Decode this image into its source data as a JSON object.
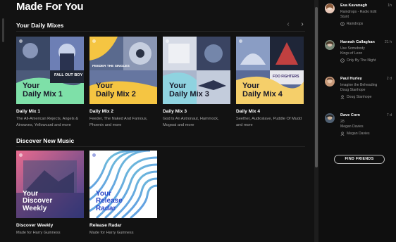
{
  "page": {
    "title": "Made For You"
  },
  "sections": {
    "daily_mixes": {
      "title": "Your Daily Mixes",
      "cards": [
        {
          "cover_label_line1": "Your",
          "cover_label_line2": "Daily Mix 1",
          "title": "Daily Mix 1",
          "subtitle": "The All-American Rejects, Angels & Airwaves, Yellowcard and more",
          "band_text": "FALL OUT BOY",
          "accent": "#7ee0a8"
        },
        {
          "cover_label_line1": "Your",
          "cover_label_line2": "Daily Mix 2",
          "title": "Daily Mix 2",
          "subtitle": "Feeder, The Naked And Famous, Phoenix and more",
          "band_text": "FEEDER THE SINGLES",
          "accent": "#f5c542"
        },
        {
          "cover_label_line1": "Your",
          "cover_label_line2": "Daily Mix 3",
          "title": "Daily Mix 3",
          "subtitle": "God Is An Astronaut, Hammock, Mogwai and more",
          "band_text": "",
          "accent": "#8fd3e0"
        },
        {
          "cover_label_line1": "Your",
          "cover_label_line2": "Daily Mix 4",
          "title": "Daily Mix 4",
          "subtitle": "Seether, Audioslave, Puddle Of Mudd and more",
          "band_text": "FOO FIGHTERS",
          "accent": "#f5cf6a"
        }
      ]
    },
    "discover": {
      "title": "Discover New Music",
      "cards": [
        {
          "cover_label_line1": "Your",
          "cover_label_line2": "Discover",
          "cover_label_line3": "Weekly",
          "title": "Discover Weekly",
          "subtitle": "Made for Harry Guinness"
        },
        {
          "cover_label_line1": "Your",
          "cover_label_line2": "Release",
          "cover_label_line3": "Radar",
          "title": "Release Radar",
          "subtitle": "Made for Harry Guinness"
        }
      ]
    }
  },
  "friends": [
    {
      "name": "Eva Kavanagh",
      "time": "1h",
      "track": "Raindrops - Radio Edit",
      "artist": "Stunt",
      "source": "Raindrops",
      "source_icon": "playlist-icon"
    },
    {
      "name": "Hannah Callaghan",
      "time": "21 h",
      "track": "Use Somebody",
      "artist": "Kings of Leon",
      "source": "Only By The Night",
      "source_icon": "album-icon"
    },
    {
      "name": "Paul Hurley",
      "time": "2 d",
      "track": "Imagine the Beheading",
      "artist": "Doug Stanhope",
      "source": "Doug Stanhope",
      "source_icon": "artist-icon"
    },
    {
      "name": "Dave Corn",
      "time": "7 d",
      "track": "28",
      "artist": "Megan Davies",
      "source": "Megan Davies",
      "source_icon": "artist-icon"
    }
  ],
  "find_friends_label": "FIND FRIENDS",
  "nav": {
    "prev": "‹",
    "next": "›"
  }
}
